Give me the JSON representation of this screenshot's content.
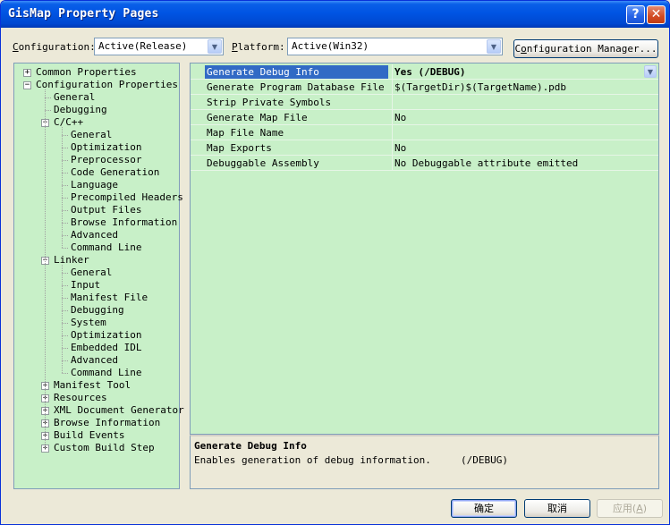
{
  "window": {
    "title": "GisMap Property Pages",
    "help_glyph": "?",
    "close_glyph": "✕"
  },
  "toolbar": {
    "config_label_key": "C",
    "config_label_rest": "onfiguration:",
    "config_value": "Active(Release)",
    "platform_label_key": "P",
    "platform_label_rest": "latform:",
    "platform_value": "Active(Win32)",
    "manager_key": "o",
    "manager_pre": "C",
    "manager_rest": "nfiguration Manager...",
    "arrow_glyph": "▼"
  },
  "tree": {
    "expand_glyph": "+",
    "collapse_glyph": "−",
    "items": [
      {
        "label": "Common Properties",
        "level": 0,
        "toggle": "plus"
      },
      {
        "label": "Configuration Properties",
        "level": 0,
        "toggle": "minus"
      },
      {
        "label": "General",
        "level": 1
      },
      {
        "label": "Debugging",
        "level": 1
      },
      {
        "label": "C/C++",
        "level": 1,
        "toggle": "minus"
      },
      {
        "label": "General",
        "level": 2
      },
      {
        "label": "Optimization",
        "level": 2
      },
      {
        "label": "Preprocessor",
        "level": 2
      },
      {
        "label": "Code Generation",
        "level": 2
      },
      {
        "label": "Language",
        "level": 2
      },
      {
        "label": "Precompiled Headers",
        "level": 2
      },
      {
        "label": "Output Files",
        "level": 2
      },
      {
        "label": "Browse Information",
        "level": 2
      },
      {
        "label": "Advanced",
        "level": 2
      },
      {
        "label": "Command Line",
        "level": 2
      },
      {
        "label": "Linker",
        "level": 1,
        "toggle": "minus"
      },
      {
        "label": "General",
        "level": 2
      },
      {
        "label": "Input",
        "level": 2
      },
      {
        "label": "Manifest File",
        "level": 2
      },
      {
        "label": "Debugging",
        "level": 2,
        "selected": true
      },
      {
        "label": "System",
        "level": 2
      },
      {
        "label": "Optimization",
        "level": 2
      },
      {
        "label": "Embedded IDL",
        "level": 2
      },
      {
        "label": "Advanced",
        "level": 2
      },
      {
        "label": "Command Line",
        "level": 2
      },
      {
        "label": "Manifest Tool",
        "level": 1,
        "toggle": "plus"
      },
      {
        "label": "Resources",
        "level": 1,
        "toggle": "plus"
      },
      {
        "label": "XML Document Generator",
        "level": 1,
        "toggle": "plus"
      },
      {
        "label": "Browse Information",
        "level": 1,
        "toggle": "plus"
      },
      {
        "label": "Build Events",
        "level": 1,
        "toggle": "plus"
      },
      {
        "label": "Custom Build Step",
        "level": 1,
        "toggle": "plus"
      }
    ]
  },
  "grid": {
    "dropdown_glyph": "▼",
    "rows": [
      {
        "name": "Generate Debug Info",
        "value": "Yes (/DEBUG)",
        "selected": true
      },
      {
        "name": "Generate Program Database File",
        "value": "$(TargetDir)$(TargetName).pdb"
      },
      {
        "name": "Strip Private Symbols",
        "value": ""
      },
      {
        "name": "Generate Map File",
        "value": "No"
      },
      {
        "name": "Map File Name",
        "value": ""
      },
      {
        "name": "Map Exports",
        "value": "No"
      },
      {
        "name": "Debuggable Assembly",
        "value": "No Debuggable attribute emitted"
      }
    ]
  },
  "description": {
    "title": "Generate Debug Info",
    "text": "Enables generation of debug information.     (/DEBUG)"
  },
  "buttons": {
    "ok": "确定",
    "cancel": "取消",
    "apply_pre": "应用(",
    "apply_key": "A",
    "apply_post": ")"
  }
}
